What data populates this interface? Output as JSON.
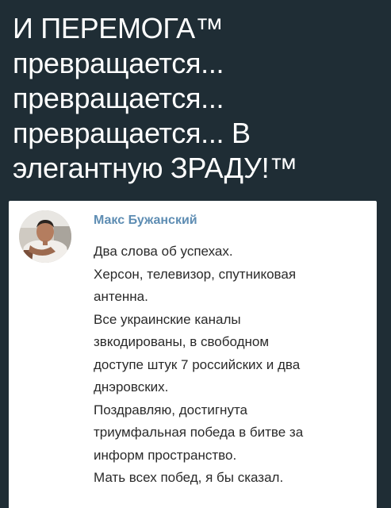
{
  "headline": {
    "lines": [
      "И ПЕРЕМОГА™",
      "превращается...",
      "превращается...",
      "превращается... В",
      "элегантную ЗРАДУ!™"
    ]
  },
  "post": {
    "author_name": "Макс Бужанский",
    "avatar_icon": "user-photo-avatar",
    "lines": [
      "Два слова об успехах.",
      "Херсон, телевизор, спутниковая",
      "антенна.",
      "Все украинские каналы",
      "звкодированы, в свободном",
      "доступе штук 7 российских и два",
      "днэровских.",
      "Поздравляю, достигнута",
      "триумфальная победа в битве за",
      "информ пространство.",
      "Мать всех побед, я бы сказал."
    ]
  }
}
